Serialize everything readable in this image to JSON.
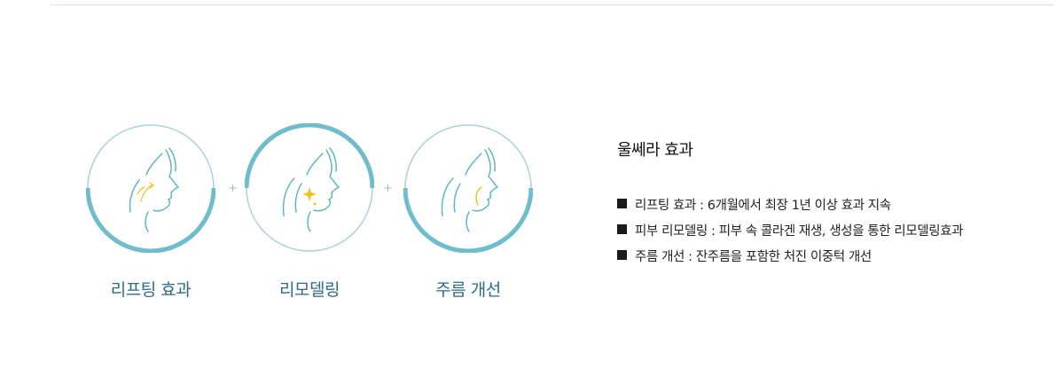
{
  "circles": [
    {
      "caption": "리프팅 효과",
      "arc": "bottom",
      "icon": "lifting-arrows-icon"
    },
    {
      "caption": "리모델링",
      "arc": "top",
      "icon": "remodeling-sparkle-icon"
    },
    {
      "caption": "주름 개선",
      "arc": "bottom",
      "icon": "wrinkle-line-icon"
    }
  ],
  "plus_sign": "+",
  "effects": {
    "title": "울쎄라 효과",
    "items": [
      "리프팅 효과 : 6개월에서 최장 1년 이상 효과 지속",
      "피부 리모델링 : 피부 속 콜라겐 재생, 생성을 통한 리모델링효과",
      "주름 개선 : 잔주름을 포함한 처진 이중턱 개선"
    ]
  },
  "colors": {
    "ring_light": "#9ecfd9",
    "ring_thick": "#6fbccc",
    "face_line": "#5fb6c6",
    "accent_yellow": "#f0c419",
    "caption": "#2d6b86"
  }
}
